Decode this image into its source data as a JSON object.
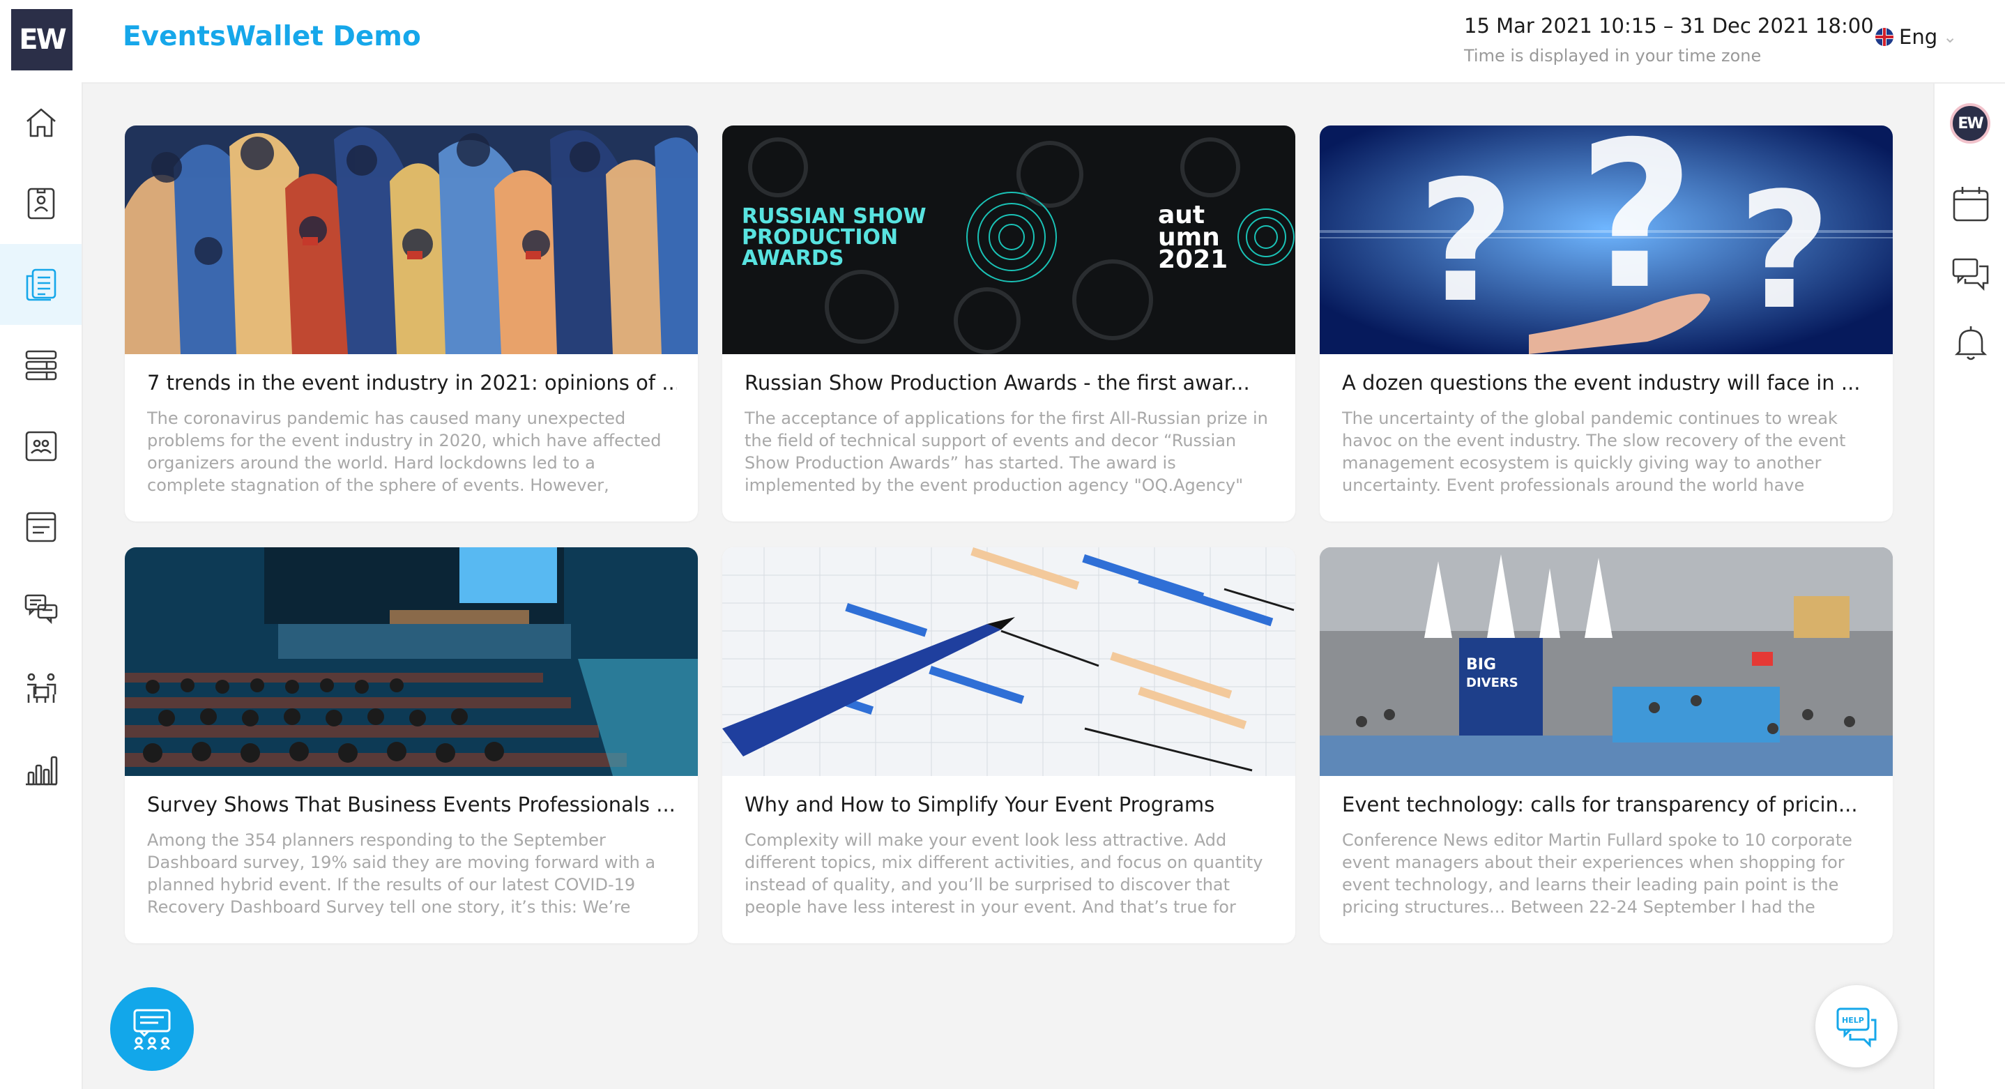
{
  "header": {
    "logo_text": "EW",
    "app_title": "EventsWallet Demo",
    "date_range": "15 Mar 2021 10:15 – 31 Dec 2021 18:00",
    "timezone_note": "Time is displayed in your time zone",
    "language": "Eng"
  },
  "sidebar": {
    "items": [
      {
        "icon": "home-icon",
        "active": false
      },
      {
        "icon": "badge-icon",
        "active": false
      },
      {
        "icon": "news-icon",
        "active": true
      },
      {
        "icon": "schedule-icon",
        "active": false
      },
      {
        "icon": "attendees-icon",
        "active": false
      },
      {
        "icon": "notes-icon",
        "active": false
      },
      {
        "icon": "meetings-icon",
        "active": false
      },
      {
        "icon": "networking-icon",
        "active": false
      },
      {
        "icon": "stats-icon",
        "active": false
      }
    ]
  },
  "rightbar": {
    "avatar_text": "EW",
    "icons": [
      "calendar-icon",
      "chat-icon",
      "bell-icon"
    ]
  },
  "articles": [
    {
      "title": "7 trends in the event industry in 2021: opinions of ...",
      "excerpt": "The coronavirus pandemic has caused many unexpected problems for the event industry in 2020, which have affected organizers around the world. Hard lockdowns led to a complete stagnation of the sphere of events. However,"
    },
    {
      "title": "Russian Show Production Awards - the first awar...",
      "excerpt": "The acceptance of applications for the first All-Russian prize in the field of technical support of events and decor “Russian Show Production Awards” has started. The award is implemented by the event production agency \"OQ.Agency\"",
      "banner_left": [
        "RUSSIAN SHOW",
        "PRODUCTION",
        "AWARDS"
      ],
      "banner_right": [
        "aut",
        "umn",
        "2021"
      ]
    },
    {
      "title": "A dozen questions the event industry will face in ...",
      "excerpt": "The uncertainty of the global pandemic continues to wreak havoc on the event industry. The slow recovery of the event management ecosystem is quickly giving way to another uncertainty. Event professionals around the world have"
    },
    {
      "title": "Survey Shows That Business Events Professionals ...",
      "excerpt": "Among the 354 planners responding to the September Dashboard survey, 19% said they are moving forward with a planned hybrid event. If the results of our latest COVID-19 Recovery Dashboard Survey tell one story, it’s this: We’re"
    },
    {
      "title": "Why and How to Simplify Your Event Programs",
      "excerpt": "Complexity will make your event look less attractive. Add different topics, mix different activities, and focus on quantity instead of quality, and you’ll be surprised to discover that people have less interest in your event. And that’s true for"
    },
    {
      "title": "Event technology: calls for transparency of pricin...",
      "excerpt": "Conference News editor Martin Fullard spoke to 10 corporate event managers about their experiences when shopping for event technology, and learns their leading pain point is the pricing structures... Between 22-24 September I had the",
      "banner_left": [
        "BIG",
        "DIVERS"
      ]
    }
  ],
  "help_label": "HELP",
  "colors": {
    "accent": "#16a7ea",
    "brand_dark": "#2b2f48"
  }
}
